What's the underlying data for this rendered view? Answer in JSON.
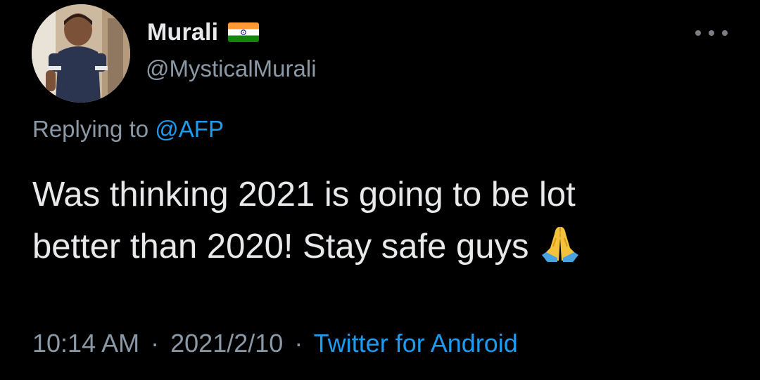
{
  "tweet": {
    "display_name": "Murali",
    "handle": "@MysticalMurali",
    "replying_prefix": "Replying to",
    "replying_mention": "@AFP",
    "text_line1": "Was thinking 2021 is going to be lot",
    "text_line2": "better than 2020! Stay safe guys",
    "time": "10:14 AM",
    "separator": "·",
    "date": "2021/2/10",
    "source": "Twitter for Android"
  },
  "icons": {
    "flag": "india-flag-icon",
    "more": "more-options-icon",
    "emoji": "folded-hands-emoji"
  },
  "colors": {
    "background": "#000000",
    "primary_text": "#e7e9ea",
    "secondary_text": "#8b98a5",
    "link": "#1d9bf0"
  }
}
